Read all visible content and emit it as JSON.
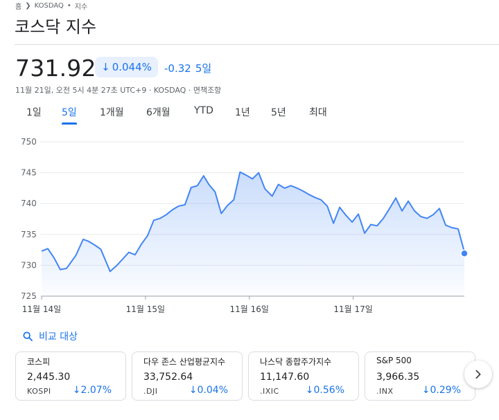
{
  "breadcrumb": {
    "home": "홈",
    "exchange": "KOSDAQ",
    "separator": "•",
    "section": "지수"
  },
  "page": {
    "title": "코스닥 지수"
  },
  "quote": {
    "price": "731.92",
    "change_pct": "0.044%",
    "change_abs": "-0.32",
    "change_period": "5일",
    "meta": "11월 21일, 오전 5시 4분 27초 UTC+9 · KOSDAQ · 면책조항"
  },
  "tabs": [
    {
      "label": "1일",
      "active": false
    },
    {
      "label": "5일",
      "active": true
    },
    {
      "label": "1개월",
      "active": false
    },
    {
      "label": "6개월",
      "active": false
    },
    {
      "label": "YTD",
      "active": false
    },
    {
      "label": "1년",
      "active": false
    },
    {
      "label": "5년",
      "active": false
    },
    {
      "label": "최대",
      "active": false
    }
  ],
  "chart_data": {
    "type": "area",
    "title": "",
    "xlabel": "",
    "ylabel": "",
    "ylim": [
      725,
      750
    ],
    "y_ticks": [
      750,
      745,
      740,
      735,
      730,
      725
    ],
    "x_ticks": [
      "11월 14일",
      "11월 15일",
      "11월 16일",
      "11월 17일"
    ],
    "x_tick_positions": [
      0,
      1,
      2,
      3
    ],
    "xlim": [
      0,
      4.07
    ],
    "grid": true,
    "legend": "none",
    "series": [
      {
        "x": [
          0.0,
          0.06,
          0.12,
          0.18,
          0.24,
          0.33,
          0.4,
          0.45,
          0.51,
          0.57,
          0.66,
          0.72,
          0.78,
          0.84,
          0.9,
          0.96,
          1.02,
          1.08,
          1.14,
          1.2,
          1.26,
          1.32,
          1.38,
          1.44,
          1.5,
          1.56,
          1.61,
          1.67,
          1.73,
          1.79,
          1.85,
          1.91,
          1.97,
          2.03,
          2.09,
          2.15,
          2.22,
          2.28,
          2.34,
          2.4,
          2.46,
          2.52,
          2.57,
          2.63,
          2.69,
          2.75,
          2.81,
          2.87,
          2.93,
          2.99,
          3.05,
          3.11,
          3.17,
          3.23,
          3.29,
          3.35,
          3.41,
          3.47,
          3.53,
          3.59,
          3.65,
          3.71,
          3.77,
          3.83,
          3.89,
          3.95,
          4.01,
          4.07
        ],
        "values": [
          732.3,
          732.7,
          731.2,
          729.3,
          729.5,
          731.6,
          734.2,
          733.9,
          733.3,
          732.6,
          729.0,
          729.9,
          731.0,
          732.1,
          731.7,
          733.4,
          734.8,
          737.3,
          737.6,
          738.2,
          739.0,
          739.6,
          739.8,
          742.6,
          742.9,
          744.5,
          743.1,
          741.9,
          738.4,
          739.7,
          740.6,
          745.1,
          744.6,
          744.0,
          745.0,
          742.4,
          741.2,
          743.1,
          742.5,
          742.9,
          742.5,
          742.0,
          741.5,
          741.0,
          740.6,
          739.6,
          736.8,
          739.4,
          738.1,
          737.0,
          738.3,
          735.2,
          736.6,
          736.4,
          737.6,
          739.2,
          740.9,
          738.8,
          740.4,
          738.8,
          737.9,
          737.6,
          738.2,
          739.2,
          736.5,
          736.1,
          735.9,
          732.2
        ],
        "current_value": 731.92
      }
    ]
  },
  "compare": {
    "label": "비교 대상",
    "icon": "search-icon"
  },
  "cards": [
    {
      "name": "코스피",
      "value": "2,445.30",
      "ticker": "KOSPI",
      "pct": "2.07%"
    },
    {
      "name": "다우 존스 산업평균지수",
      "value": "33,752.64",
      "ticker": ".DJI",
      "pct": "0.04%"
    },
    {
      "name": "나스닥 종합주가지수",
      "value": "11,147.60",
      "ticker": ".IXIC",
      "pct": "0.56%"
    },
    {
      "name": "S&P 500",
      "value": "3,966.35",
      "ticker": ".INX",
      "pct": "0.29%"
    }
  ],
  "colors": {
    "accent": "#1a73e8",
    "line": "#4285f4",
    "grid": "#e8eaed",
    "text_secondary": "#5f6368",
    "card_border": "#dadce0"
  }
}
